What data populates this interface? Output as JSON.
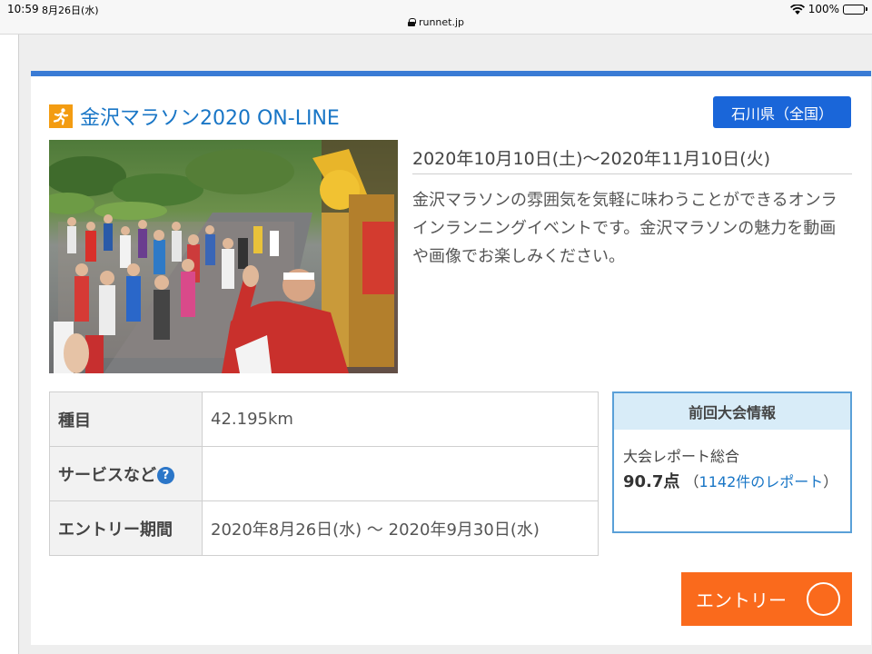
{
  "status_bar": {
    "time": "10:59",
    "date": "8月26日(水)",
    "url": "runnet.jp",
    "battery": "100%"
  },
  "event": {
    "title": "金沢マラソン2020 ON-LINE",
    "region": "石川県（全国）",
    "date_range": "2020年10月10日(土)〜2020年11月10日(火)",
    "description": "金沢マラソンの雰囲気を気軽に味わうことができるオンラインランニングイベントです。金沢マラソンの魅力を動画や画像でお楽しみください。"
  },
  "details": {
    "rows": [
      {
        "label": "種目",
        "value": "42.195km"
      },
      {
        "label": "サービスなど",
        "value": "",
        "help": "?"
      },
      {
        "label": "エントリー期間",
        "value": "2020年8月26日(水) 〜 2020年9月30日(水)"
      }
    ]
  },
  "previous": {
    "header": "前回大会情報",
    "report_label": "大会レポート総合",
    "score": "90.7点",
    "report_open": "（",
    "report_link": "1142件のレポート",
    "report_close": "）"
  },
  "entry_button": {
    "label": "エントリー"
  },
  "colors": {
    "accent_blue": "#3a7bd5",
    "region_button": "#1a66d9",
    "title_blue": "#1976c6",
    "entry_orange": "#fa6a1c",
    "runner_icon": "#f39c12"
  }
}
